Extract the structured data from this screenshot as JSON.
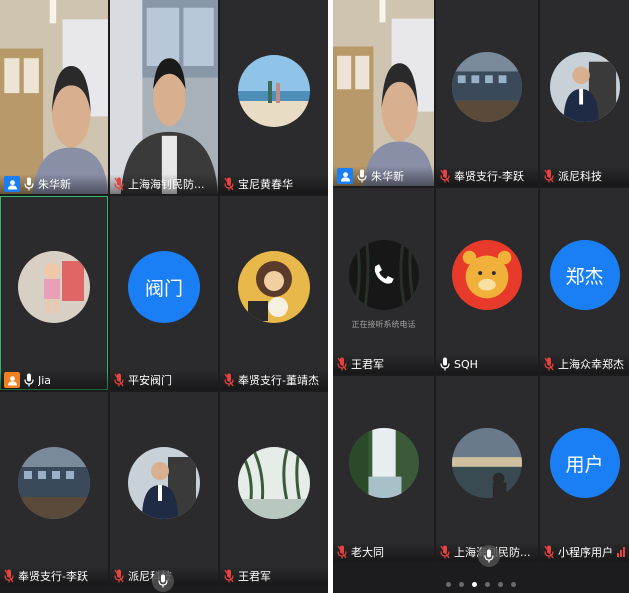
{
  "colors": {
    "host_badge": "#1a7ff5",
    "host_badge_speaking": "#f08020",
    "mic_muted": "#e8413e",
    "active_border": "#2fb86a",
    "avatar_blue": "#1a7ff5",
    "signal_red": "#e8413e"
  },
  "left": {
    "tiles": [
      {
        "name": "朱华新",
        "kind": "video",
        "mic": "on",
        "host": "blue"
      },
      {
        "name": "上海海钊民防...",
        "kind": "video",
        "mic": "muted"
      },
      {
        "name": "宝尼黄春华",
        "kind": "photo",
        "mic": "muted",
        "icon": "beach-photo"
      },
      {
        "name": "Jia",
        "kind": "photo",
        "mic": "on",
        "host": "orange",
        "icon": "child-photo"
      },
      {
        "name": "平安阀门",
        "kind": "text",
        "avatar_text": "阀门",
        "mic": "muted"
      },
      {
        "name": "奉贤支行-董靖杰",
        "kind": "photo",
        "mic": "muted",
        "icon": "cartoon-photo"
      },
      {
        "name": "奉贤支行-李跃",
        "kind": "photo",
        "mic": "muted",
        "icon": "building-photo"
      },
      {
        "name": "派尼科技",
        "kind": "photo",
        "mic": "muted",
        "icon": "businessman-photo"
      },
      {
        "name": "王君军",
        "kind": "photo",
        "mic": "muted",
        "icon": "willow-photo"
      }
    ]
  },
  "right": {
    "tiles": [
      {
        "name": "朱华新",
        "kind": "video",
        "mic": "on",
        "host": "blue"
      },
      {
        "name": "奉贤支行-李跃",
        "kind": "photo",
        "mic": "muted",
        "icon": "building-photo"
      },
      {
        "name": "派尼科技",
        "kind": "photo",
        "mic": "muted",
        "icon": "businessman-photo"
      },
      {
        "name": "王君军",
        "kind": "photo",
        "mic": "muted",
        "icon": "phone-icon",
        "status": "正在接听系统电话"
      },
      {
        "name": "SQH",
        "kind": "photo",
        "mic": "on",
        "icon": "bear-photo"
      },
      {
        "name": "上海众幸郑杰",
        "kind": "text",
        "avatar_text": "郑杰",
        "mic": "muted"
      },
      {
        "name": "老大同",
        "kind": "photo",
        "mic": "muted",
        "icon": "waterfall-photo"
      },
      {
        "name": "上海海钊民防...",
        "kind": "photo",
        "mic": "muted",
        "icon": "sunset-photo"
      },
      {
        "name": "小程序用户",
        "kind": "text",
        "avatar_text": "用户",
        "mic": "muted",
        "signal": true
      }
    ],
    "page_dots": 6,
    "active_dot": 2
  }
}
